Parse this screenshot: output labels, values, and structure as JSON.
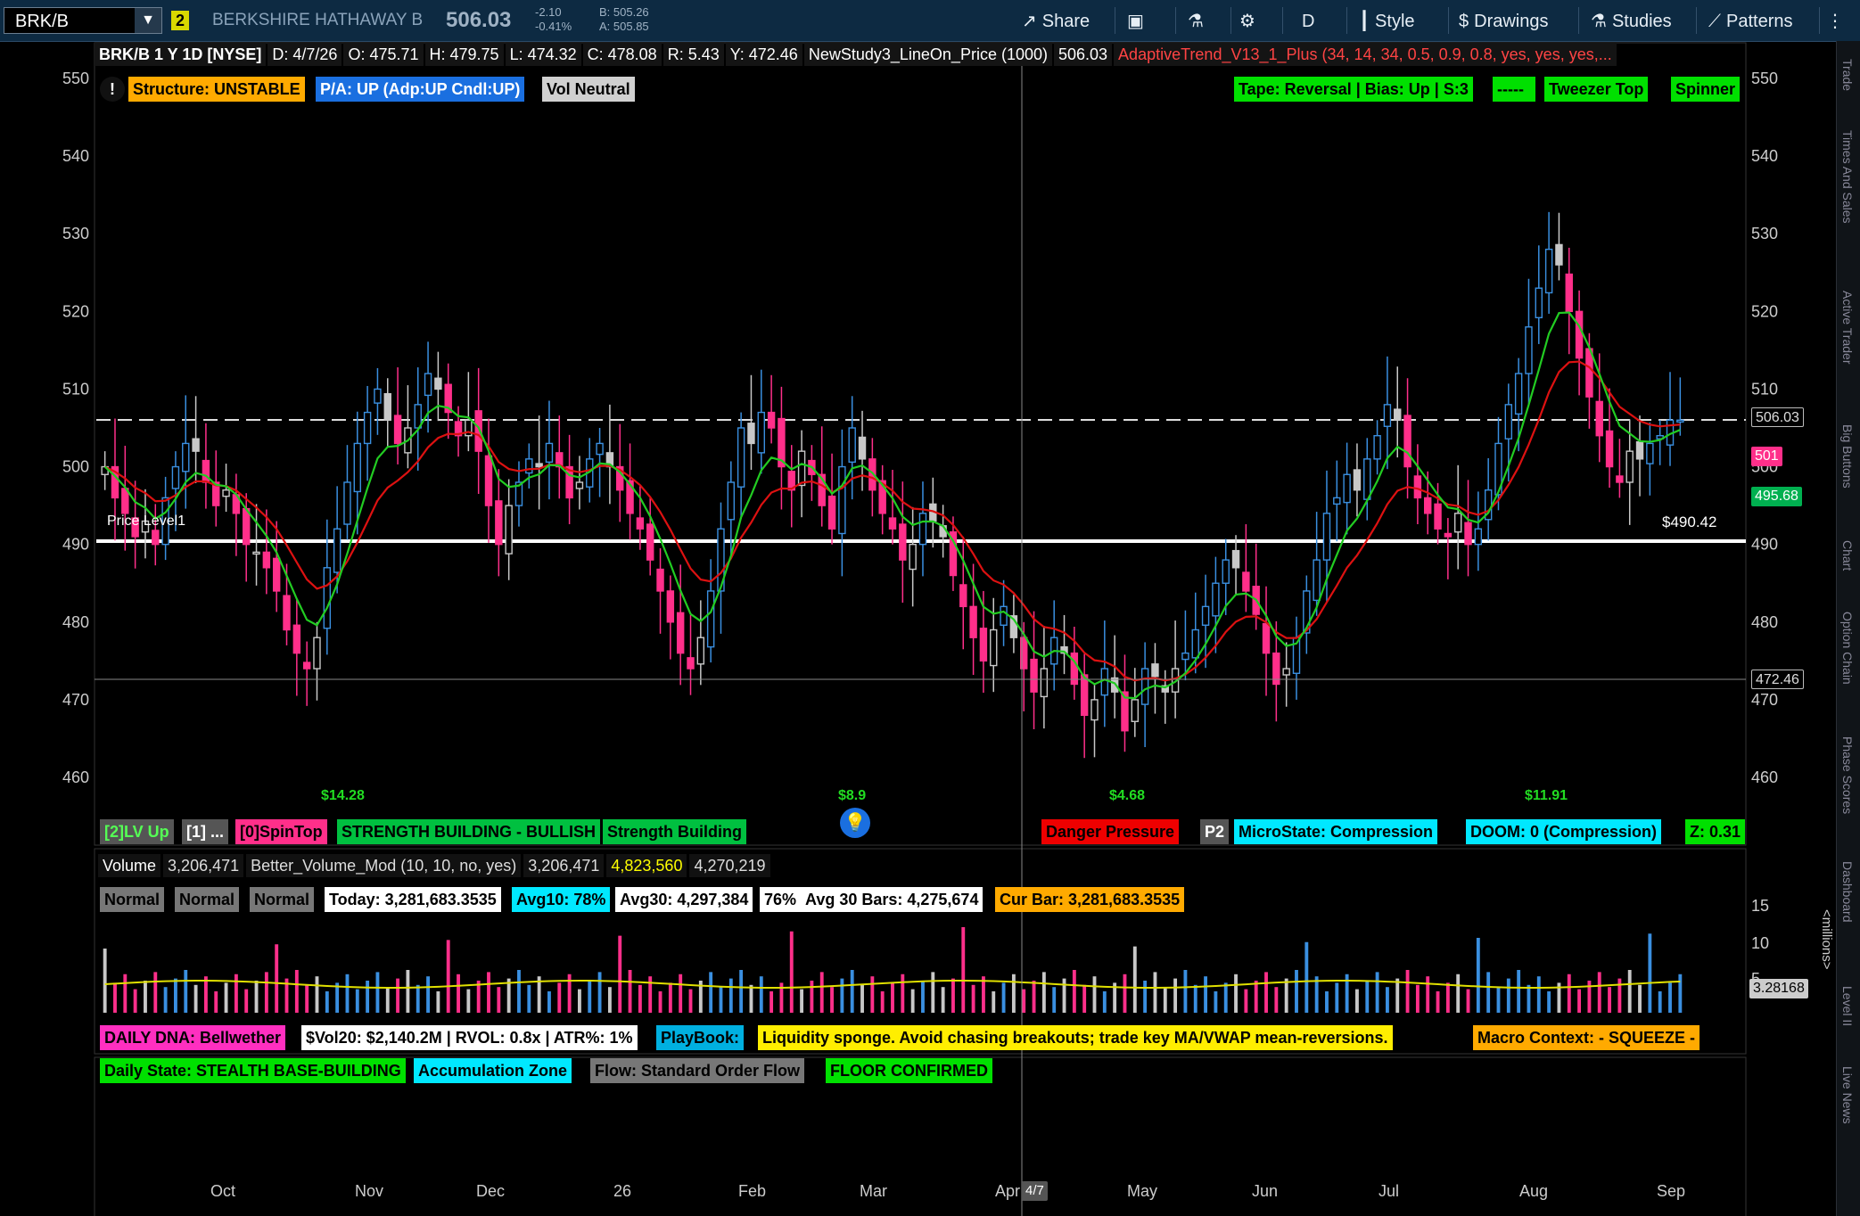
{
  "toolbar": {
    "symbol": "BRK/B",
    "link_badge": "2",
    "company": "BERKSHIRE HATHAWAY B",
    "last_price": "506.03",
    "change": "-2.10",
    "change_pct": "-0.41%",
    "bid": "B: 505.26",
    "ask": "A: 505.85",
    "share": "Share",
    "period": "D",
    "style": "Style",
    "drawings": "Drawings",
    "studies": "Studies",
    "patterns": "Patterns"
  },
  "right_tabs": [
    "Trade",
    "Times And Sales",
    "Active Trader",
    "Big Buttons",
    "Chart",
    "Option Chain",
    "Phase Scores",
    "Dashboard",
    "Level II",
    "Live News"
  ],
  "header": {
    "title": "BRK/B 1 Y 1D [NYSE]",
    "date": "D: 4/7/26",
    "open": "O: 475.71",
    "high": "H: 479.75",
    "low": "L: 474.32",
    "close": "C: 478.08",
    "range": "R: 5.43",
    "y": "Y: 472.46",
    "study3": "NewStudy3_LineOn_Price (1000)",
    "study3_val": "506.03",
    "adaptive": "AdaptiveTrend_V13_1_Plus (34, 14, 34, 0.5, 0.9, 0.8, yes, yes, yes,..."
  },
  "top_labels": {
    "structure": "Structure: UNSTABLE",
    "pa": "P/A: UP  (Adp:UP  Cndl:UP)",
    "vol": "Vol Neutral",
    "tape": "Tape: Reversal | Bias: Up | S:3",
    "dash": "-----",
    "tweezer": "Tweezer Top",
    "spinner": "Spinner"
  },
  "bottom_labels": {
    "lv": "[2]LV Up",
    "one": "[1] ...",
    "spin": "[0]SpinTop",
    "strength_bull": "STRENGTH BUILDING - BULLISH",
    "strength": "Strength Building",
    "danger": "Danger Pressure",
    "p2": "P2",
    "micro": "MicroState: Compression",
    "doom": "DOOM: 0 (Compression)",
    "z": "Z: 0.31"
  },
  "dividends": [
    "$14.28",
    "$8.9",
    "$4.68",
    "$11.91"
  ],
  "price_level": {
    "label": "Price Level1",
    "value": "$490.42"
  },
  "price_axis": {
    "ticks": [
      550,
      540,
      530,
      520,
      510,
      500,
      490,
      480,
      470,
      460
    ],
    "badges": {
      "last": "506.03",
      "mid": "501",
      "support": "495.68",
      "y": "472.46"
    }
  },
  "volume_header": {
    "volume": "Volume",
    "volume_val": "3,206,471",
    "better": "Better_Volume_Mod (10, 10, no, yes)",
    "better_val": "3,206,471",
    "v2": "4,823,560",
    "v3": "4,270,219"
  },
  "volume_labels": {
    "n1": "Normal",
    "n2": "Normal",
    "n3": "Normal",
    "today": "Today: 3,281,683.3535",
    "avg10": "Avg10: 78%",
    "avg30": "Avg30: 4,297,384",
    "pct": "76%",
    "avg30bars": "Avg 30 Bars: 4,275,674",
    "curbar": "Cur Bar: 3,281,683.3535"
  },
  "volume_axis": {
    "ticks": [
      "15",
      "10",
      "5"
    ],
    "unit": "<millions>",
    "badge": "3.28168"
  },
  "dna_labels": {
    "dna": "DAILY DNA: Bellwether",
    "vol20": "$Vol20: $2,140.2M | RVOL: 0.8x | ATR%: 1%",
    "playbook": "PlayBook:",
    "liquidity": "Liquidity sponge. Avoid chasing breakouts; trade key MA/VWAP mean-reversions.",
    "macro": "Macro Context:  - SQUEEZE -",
    "daily_state": "Daily State: STEALTH BASE-BUILDING",
    "accum": "Accumulation Zone",
    "flow": "Flow: Standard Order Flow",
    "floor": "FLOOR CONFIRMED"
  },
  "months": [
    "Oct",
    "Nov",
    "Dec",
    "26",
    "Feb",
    "Mar",
    "Apr",
    "May",
    "Jun",
    "Jul",
    "Aug",
    "Sep"
  ],
  "crosshair_date": "4/7",
  "colors": {
    "up": "#3a8fe0",
    "down": "#ff2f8a",
    "neutral": "#c8c8c8",
    "fast_ma": "#22cc22",
    "slow_ma": "#dd1111",
    "vol_avg": "#e0e000"
  },
  "chart_data": {
    "type": "candlestick",
    "y_range": [
      455,
      552
    ],
    "closes": [
      500,
      496,
      494,
      491,
      493,
      490,
      496,
      500,
      503,
      502,
      498,
      495,
      497,
      494,
      490,
      489,
      487,
      484,
      479,
      476,
      474,
      478,
      487,
      492,
      498,
      503,
      507,
      510,
      506,
      503,
      505,
      508,
      512,
      510,
      507,
      504,
      506,
      502,
      495,
      490,
      495,
      498,
      501,
      500,
      503,
      500,
      496,
      498,
      501,
      503,
      500,
      497,
      494,
      492,
      488,
      484,
      480,
      476,
      474,
      478,
      484,
      492,
      498,
      505,
      503,
      507,
      505,
      500,
      497,
      502,
      499,
      495,
      492,
      500,
      505,
      501,
      497,
      494,
      492,
      488,
      490,
      494,
      493,
      491,
      486,
      482,
      478,
      475,
      479,
      482,
      478,
      474,
      471,
      474,
      478,
      476,
      472,
      468,
      470,
      474,
      471,
      466,
      470,
      474,
      473,
      471,
      474,
      476,
      479,
      482,
      485,
      488,
      487,
      484,
      481,
      476,
      472,
      474,
      478,
      484,
      488,
      494,
      496,
      499,
      497,
      501,
      504,
      508,
      506,
      500,
      496,
      494,
      492,
      491,
      494,
      490,
      492,
      497,
      503,
      508,
      512,
      518,
      523,
      528,
      526,
      520,
      514,
      509,
      504,
      500,
      498,
      502,
      501,
      503,
      504,
      506,
      506
    ]
  }
}
